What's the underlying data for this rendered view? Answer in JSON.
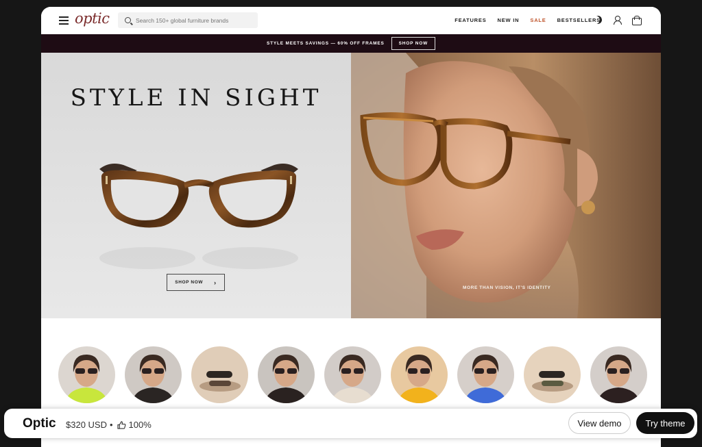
{
  "header": {
    "logo": "optic",
    "search_placeholder": "Search 150+ global furniture brands",
    "nav": [
      "FEATURES",
      "NEW IN",
      "SALE",
      "BESTSELLERS"
    ]
  },
  "promo": {
    "text": "STYLE MEETS SAVINGS — 60% OFF FRAMES",
    "button": "SHOP NOW"
  },
  "hero": {
    "title": "STYLE IN SIGHT",
    "shop_button": "SHOP NOW",
    "tagline": "MORE THAN VISION, IT'S IDENTITY"
  },
  "stories": [
    {
      "bg": "#dcd6d0",
      "accent": "#c8e63c"
    },
    {
      "bg": "#cfc9c4",
      "accent": "#2a2523"
    },
    {
      "bg": "#e0cdb8",
      "accent": "#5a4638"
    },
    {
      "bg": "#c9c4bf",
      "accent": "#2a2220"
    },
    {
      "bg": "#d2ccc8",
      "accent": "#e7ddd0"
    },
    {
      "bg": "#e8c9a0",
      "accent": "#f2b21c"
    },
    {
      "bg": "#d6cfca",
      "accent": "#3f6bd8"
    },
    {
      "bg": "#e6d3bd",
      "accent": "#5a5a40"
    },
    {
      "bg": "#d4ceca",
      "accent": "#2c2020"
    }
  ],
  "bottom_bar": {
    "title": "Optic",
    "price": "$320 USD",
    "separator": "•",
    "rating": "100%",
    "view_demo": "View demo",
    "try_theme": "Try theme"
  }
}
